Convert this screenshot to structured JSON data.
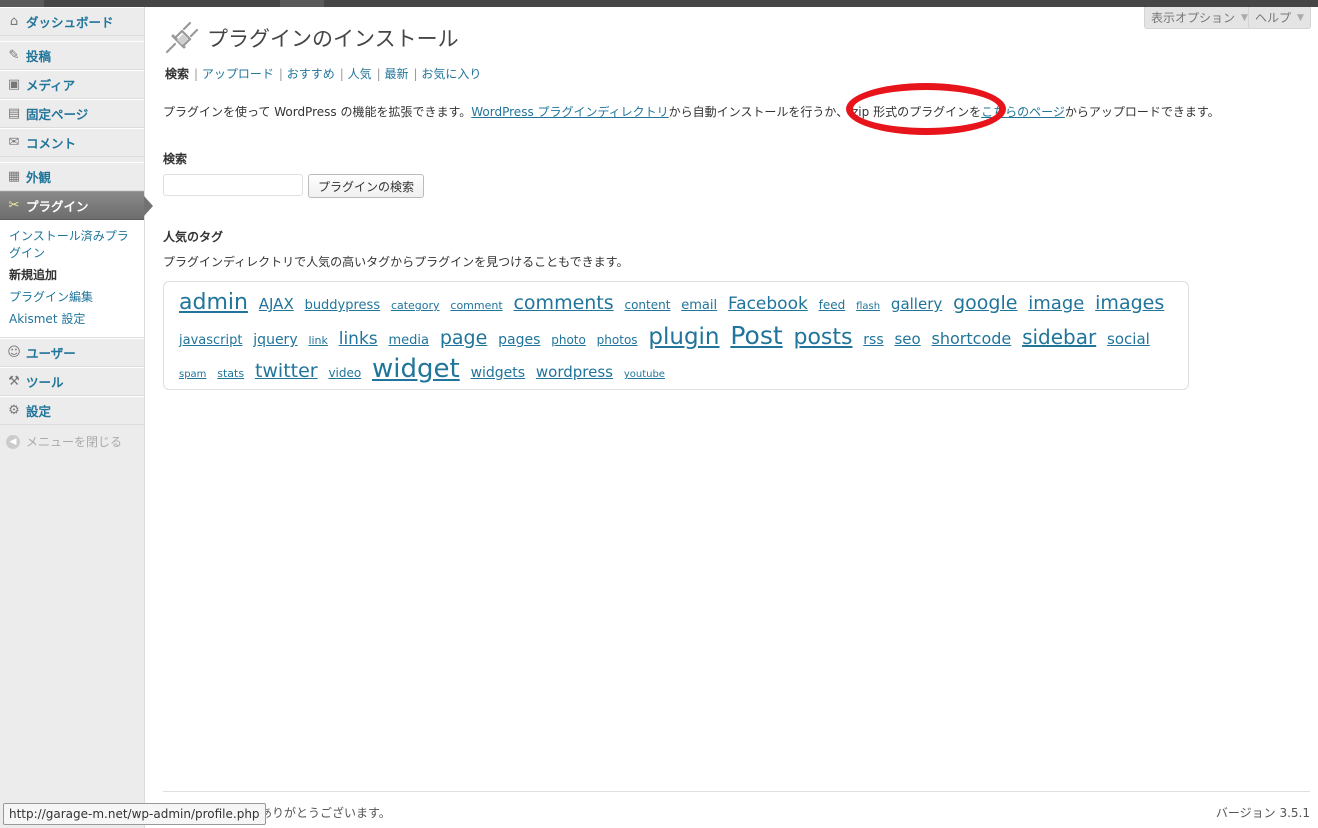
{
  "sidebar": {
    "items": [
      {
        "label": "ダッシュボード",
        "icon": "⌂",
        "icon_name": "dashboard-icon"
      },
      {
        "label": "投稿",
        "icon": "✎",
        "icon_name": "pin-icon"
      },
      {
        "label": "メディア",
        "icon": "▣",
        "icon_name": "media-icon"
      },
      {
        "label": "固定ページ",
        "icon": "▤",
        "icon_name": "page-icon"
      },
      {
        "label": "コメント",
        "icon": "✉",
        "icon_name": "comment-icon"
      },
      {
        "label": "外観",
        "icon": "▦",
        "icon_name": "appearance-icon"
      },
      {
        "label": "プラグイン",
        "icon": "✂",
        "icon_name": "plugin-icon"
      },
      {
        "label": "ユーザー",
        "icon": "☺",
        "icon_name": "users-icon"
      },
      {
        "label": "ツール",
        "icon": "⚒",
        "icon_name": "tools-icon"
      },
      {
        "label": "設定",
        "icon": "⚙",
        "icon_name": "settings-icon"
      }
    ],
    "submenu": [
      "インストール済みプラグイン",
      "新規追加",
      "プラグイン編集",
      "Akismet 設定"
    ],
    "collapse_label": "メニューを閉じる"
  },
  "header": {
    "screen_options": "表示オプション",
    "help": "ヘルプ"
  },
  "main": {
    "title": "プラグインのインストール",
    "subnav": [
      "検索",
      "アップロード",
      "おすすめ",
      "人気",
      "最新",
      "お気に入り"
    ],
    "intro_before": "プラグインを使って WordPress の機能を拡張できます。",
    "intro_link1": "WordPress プラグインディレクトリ",
    "intro_middle": "から自動インストールを行うか、.zip 形式のプラグインを",
    "intro_link2": "こちらのページ",
    "intro_after": "からアップロードできます。",
    "search_heading": "検索",
    "search_button": "プラグインの検索",
    "tags_heading": "人気のタグ",
    "tags_desc": "プラグインディレクトリで人気の高いタグからプラグインを見つけることもできます。",
    "tags": [
      {
        "t": "admin",
        "s": 22
      },
      {
        "t": "AJAX",
        "s": 15
      },
      {
        "t": "buddypress",
        "s": 13
      },
      {
        "t": "category",
        "s": 11
      },
      {
        "t": "comment",
        "s": 11
      },
      {
        "t": "comments",
        "s": 19
      },
      {
        "t": "content",
        "s": 12
      },
      {
        "t": "email",
        "s": 13
      },
      {
        "t": "Facebook",
        "s": 17
      },
      {
        "t": "feed",
        "s": 12
      },
      {
        "t": "flash",
        "s": 10
      },
      {
        "t": "gallery",
        "s": 15
      },
      {
        "t": "google",
        "s": 19
      },
      {
        "t": "image",
        "s": 18
      },
      {
        "t": "images",
        "s": 19
      },
      {
        "t": "javascript",
        "s": 13
      },
      {
        "t": "jquery",
        "s": 14
      },
      {
        "t": "link",
        "s": 11
      },
      {
        "t": "links",
        "s": 17
      },
      {
        "t": "media",
        "s": 13
      },
      {
        "t": "page",
        "s": 19
      },
      {
        "t": "pages",
        "s": 14
      },
      {
        "t": "photo",
        "s": 12
      },
      {
        "t": "photos",
        "s": 12
      },
      {
        "t": "plugin",
        "s": 23
      },
      {
        "t": "Post",
        "s": 25
      },
      {
        "t": "posts",
        "s": 22
      },
      {
        "t": "rss",
        "s": 14
      },
      {
        "t": "seo",
        "s": 15
      },
      {
        "t": "shortcode",
        "s": 16
      },
      {
        "t": "sidebar",
        "s": 20
      },
      {
        "t": "social",
        "s": 15
      },
      {
        "t": "spam",
        "s": 10
      },
      {
        "t": "stats",
        "s": 11
      },
      {
        "t": "twitter",
        "s": 19
      },
      {
        "t": "video",
        "s": 12
      },
      {
        "t": "widget",
        "s": 26
      },
      {
        "t": "widgets",
        "s": 14
      },
      {
        "t": "wordpress",
        "s": 15
      },
      {
        "t": "youtube",
        "s": 10
      }
    ]
  },
  "footer": {
    "thanks": "ありがとうございます。",
    "version": "バージョン 3.5.1"
  },
  "statusbar": {
    "url": "http://garage-m.net/wp-admin/profile.php"
  },
  "colors": {
    "link": "#21759b",
    "annotation": "#e8141b",
    "active_menu": "#777777"
  }
}
